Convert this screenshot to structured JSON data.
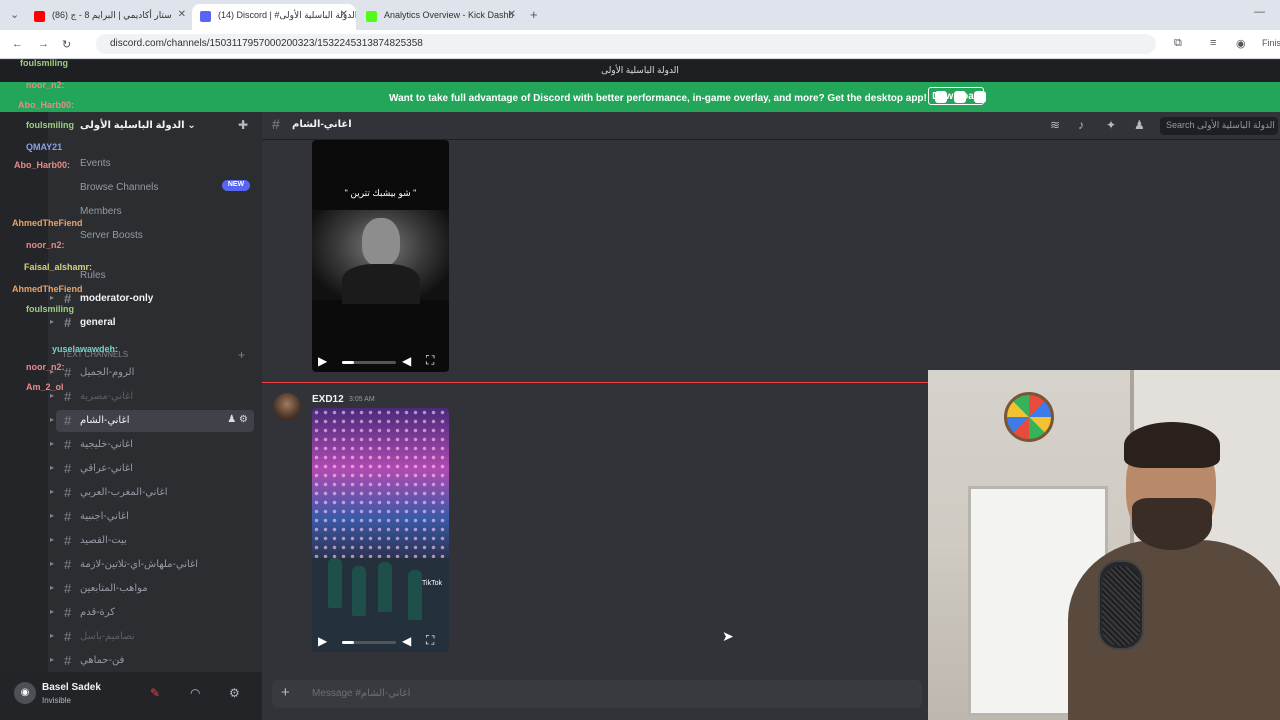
{
  "browser": {
    "tabs": [
      {
        "title": "(86) ستار أكاديمي | البرايم 8 - ج",
        "fav_color": "#ff0000"
      },
      {
        "title": "(14) Discord | #اغاني-الشام | الدولة الباسلية الأولى",
        "fav_color": "#5865f2"
      },
      {
        "title": "Analytics Overview - Kick Dashb",
        "fav_color": "#53fc18"
      }
    ],
    "url": "discord.com/channels/1503117957000200323/1532245313874825358",
    "finish_label": "Finis"
  },
  "discord": {
    "window_title": "الدولة الباسلية الأولى",
    "promo_text": "Want to take full advantage of Discord with better performance, in-game overlay, and more? Get the desktop app!",
    "download_label": "Download",
    "server_name": "الدولة الباسلية الأولى",
    "nav": {
      "events": "Events",
      "browse": "Browse Channels",
      "new_badge": "NEW",
      "members": "Members",
      "boosts": "Server Boosts",
      "rules": "Rules"
    },
    "category": "Text Channels",
    "channels": [
      {
        "name": "moderator-only",
        "style": "bold"
      },
      {
        "name": "general",
        "style": "bold"
      },
      {
        "name": "الروم-الجميل",
        "style": "normal"
      },
      {
        "name": "اغاني-مصرية",
        "style": "dim"
      },
      {
        "name": "اغاني-الشام",
        "style": "sel"
      },
      {
        "name": "اغاني-خليجية",
        "style": "normal"
      },
      {
        "name": "اغاني-عراقي",
        "style": "normal"
      },
      {
        "name": "اغاني-المغرب-العربي",
        "style": "normal"
      },
      {
        "name": "اغاني-اجنبية",
        "style": "normal"
      },
      {
        "name": "بيت-القصيد",
        "style": "normal"
      },
      {
        "name": "اغاني-ملهاش-اي-تلاتين-لازمة",
        "style": "normal"
      },
      {
        "name": "مواهب-المتابعين",
        "style": "normal"
      },
      {
        "name": "كرة-قدم",
        "style": "normal"
      },
      {
        "name": "تصاميم-باسل",
        "style": "dim"
      },
      {
        "name": "فن-حماهي",
        "style": "normal"
      }
    ],
    "overlay_names": [
      {
        "text": "foulsmiling",
        "color": "#9ad07a"
      },
      {
        "text": "noor_n2:",
        "color": "#e88a8a"
      },
      {
        "text": "Abo_Harb00:",
        "color": "#e88a8a"
      },
      {
        "text": "foulsmiling",
        "color": "#9ad07a"
      },
      {
        "text": "QMAY21",
        "color": "#8aa0e8"
      },
      {
        "text": "Abo_Harb00:",
        "color": "#e88a8a"
      },
      {
        "text": "AhmedTheFiend",
        "color": "#e8a36a"
      },
      {
        "text": "noor_n2:",
        "color": "#e88a8a"
      },
      {
        "text": "Faisal_alshamr:",
        "color": "#d7d27a"
      },
      {
        "text": "AhmedTheFiend",
        "color": "#e8a36a"
      },
      {
        "text": "foulsmiling",
        "color": "#9ad07a"
      },
      {
        "text": "yuselawawdeh:",
        "color": "#7ad0c8"
      },
      {
        "text": "noor_n2:",
        "color": "#e88a8a"
      },
      {
        "text": "Am_2_ol",
        "color": "#e88a8a"
      }
    ],
    "user": {
      "name": "Basel Sadek",
      "status": "Invisible"
    },
    "channel_header": {
      "title": "اغاني-الشام",
      "search_placeholder": "Search الدولة الباسلية الأولى"
    },
    "messages": [
      {
        "video_caption": "\" شو بيشبك تترين \""
      },
      {
        "author": "EXD12",
        "time": "3:05 AM",
        "video_watermark": "TikTok"
      }
    ],
    "input_placeholder": "Message #اغاني-الشام"
  }
}
